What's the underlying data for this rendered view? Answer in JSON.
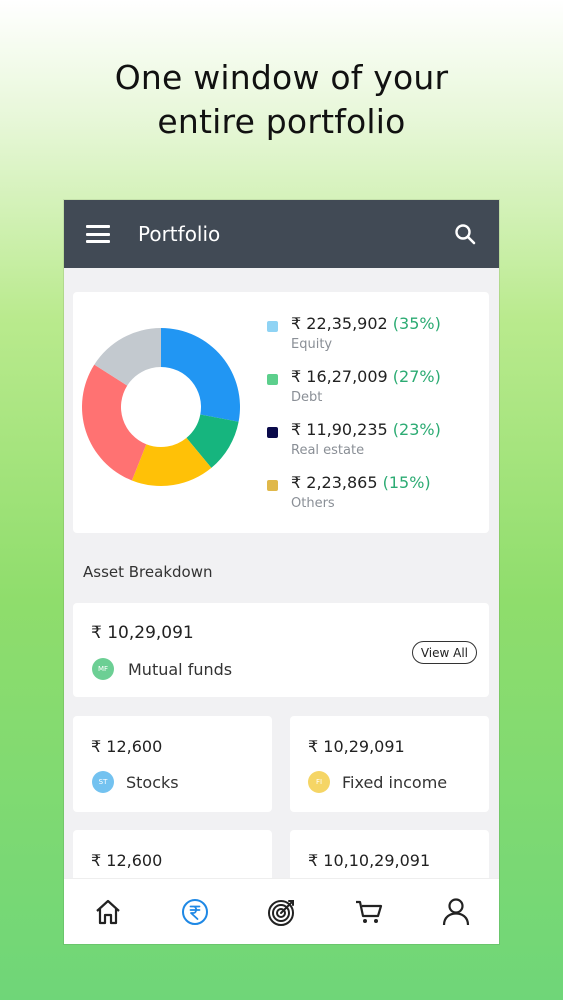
{
  "headline": {
    "line1": "One window of your",
    "line2": "entire portfolio"
  },
  "appbar": {
    "title": "Portfolio",
    "menu_icon": "menu-icon",
    "search_icon": "search-icon"
  },
  "summary": {
    "items": [
      {
        "amount": "₹ 22,35,902",
        "pct": "(35%)",
        "label": "Equity",
        "color": "#8fd3f4"
      },
      {
        "amount": "₹ 16,27,009",
        "pct": "(27%)",
        "label": "Debt",
        "color": "#5ccf8c"
      },
      {
        "amount": "₹ 11,90,235",
        "pct": "(23%)",
        "label": "Real estate",
        "color": "#0a0a4a"
      },
      {
        "amount": "₹ 2,23,865",
        "pct": "(15%)",
        "label": "Others",
        "color": "#e0b84a"
      }
    ]
  },
  "chart_data": {
    "type": "pie",
    "donut": true,
    "segments": [
      {
        "value": 28,
        "color": "#2196f3"
      },
      {
        "value": 11,
        "color": "#16b57e"
      },
      {
        "value": 17,
        "color": "#ffc107"
      },
      {
        "value": 28,
        "color": "#ff7272"
      },
      {
        "value": 16,
        "color": "#c3c9cf"
      }
    ]
  },
  "breakdown": {
    "title": "Asset Breakdown",
    "mutual_funds": {
      "amount": "₹ 10,29,091",
      "label": "Mutual funds",
      "badge": "MF",
      "badge_color": "#6ccf94",
      "view_all": "View All"
    },
    "stocks": {
      "amount": "₹ 12,600",
      "label": "Stocks",
      "badge": "ST",
      "badge_color": "#73c2f0"
    },
    "fixed_income": {
      "amount": "₹ 10,29,091",
      "label": "Fixed income",
      "badge": "FI",
      "badge_color": "#f5d565"
    },
    "card4": {
      "amount": "₹ 12,600"
    },
    "card5": {
      "amount": "₹ 10,10,29,091"
    }
  },
  "nav": {
    "items": [
      {
        "icon": "home-icon",
        "active": false
      },
      {
        "icon": "rupee-icon",
        "active": true
      },
      {
        "icon": "target-icon",
        "active": false
      },
      {
        "icon": "cart-icon",
        "active": false
      },
      {
        "icon": "profile-icon",
        "active": false
      }
    ],
    "active_color": "#1e88e5"
  }
}
